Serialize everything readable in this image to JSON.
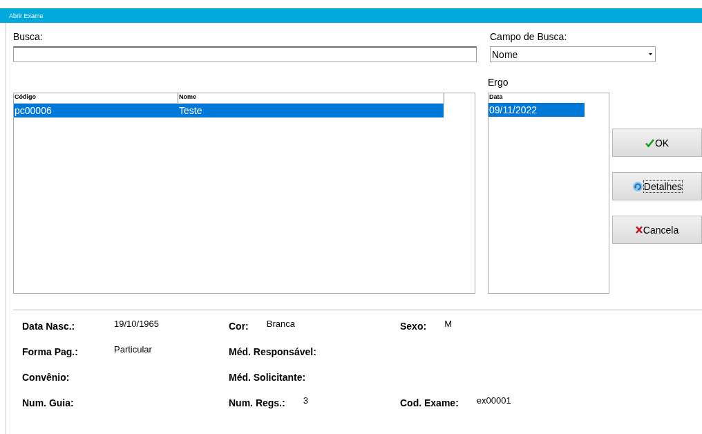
{
  "window": {
    "title": "Abrir Exame"
  },
  "search": {
    "label": "Busca:"
  },
  "search_field": {
    "label": "Campo de Busca:",
    "value": "Nome"
  },
  "patients": {
    "columns": [
      "Código",
      "Nome"
    ],
    "rows": [
      {
        "cells": [
          "pc00006",
          "Teste"
        ],
        "selected": true
      }
    ]
  },
  "exams": {
    "label": "Ergo",
    "columns": [
      "Data"
    ],
    "rows": [
      {
        "cells": [
          "09/11/2022"
        ],
        "selected": true
      }
    ]
  },
  "buttons": [
    {
      "kind": "ok",
      "label": "OK",
      "focused": false
    },
    {
      "kind": "details",
      "label": "Detalhes",
      "focused": true
    },
    {
      "kind": "cancel",
      "label": "Cancela",
      "focused": false
    }
  ],
  "details": [
    [
      {
        "label": "Data Nasc.:",
        "value": "19/10/1965"
      },
      {
        "label": "Cor:",
        "value": "Branca"
      },
      {
        "label": "Sexo:",
        "value": "M"
      }
    ],
    [
      {
        "label": "Forma Pag.:",
        "value": "Particular"
      },
      {
        "label": "Méd. Responsável:"
      }
    ],
    [
      {
        "label": "Convênio:"
      },
      {
        "label": "Méd. Solicitante:"
      }
    ],
    [
      {
        "label": "Num. Guia:"
      },
      {
        "label": "Num. Regs.:",
        "value": "3"
      },
      {
        "label": "Cod. Exame:",
        "value": "ex00001"
      }
    ]
  ]
}
